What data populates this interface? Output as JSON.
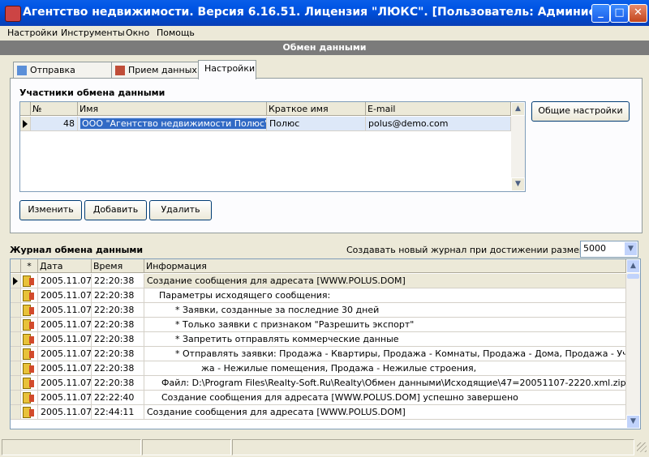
{
  "window": {
    "title": "Агентство недвижимости. Версия 6.16.51. Лицензия \"ЛЮКС\". [Пользователь: Администратор]"
  },
  "menu": [
    "Настройки",
    "Инструменты",
    "Окно",
    "Помощь"
  ],
  "section_title": "Обмен данными",
  "tabs": [
    {
      "label": "Отправка данных",
      "icon": "send-icon"
    },
    {
      "label": "Прием данных",
      "icon": "receive-icon"
    },
    {
      "label": "Настройки",
      "active": true
    }
  ],
  "participants": {
    "title": "Участники обмена данными",
    "columns": [
      "№",
      "Имя",
      "Краткое имя",
      "E-mail"
    ],
    "rows": [
      {
        "num": "48",
        "name": "ООО \"Агентство недвижимости Полюс\"",
        "short": "Полюс",
        "email": "polus@demo.com"
      }
    ],
    "buttons": {
      "edit": "Изменить",
      "add": "Добавить",
      "delete": "Удалить"
    },
    "general_settings": "Общие настройки"
  },
  "log": {
    "title": "Журнал обмена данными",
    "size_label": "Создавать новый журнал при достижении размера, Кб:",
    "size_value": "5000",
    "columns": [
      "*",
      "Дата",
      "Время",
      "Информация"
    ],
    "rows": [
      {
        "date": "2005.11.07",
        "time": "22:20:38",
        "info": "Создание сообщения для адресата [WWW.POLUS.DOM]"
      },
      {
        "date": "2005.11.07",
        "time": "22:20:38",
        "info": "Параметры исходящего сообщения:"
      },
      {
        "date": "2005.11.07",
        "time": "22:20:38",
        "info": "* Заявки, созданные за последние 30 дней"
      },
      {
        "date": "2005.11.07",
        "time": "22:20:38",
        "info": "* Только заявки с признаком \"Разрешить экспорт\""
      },
      {
        "date": "2005.11.07",
        "time": "22:20:38",
        "info": "* Запретить отправлять коммерческие данные"
      },
      {
        "date": "2005.11.07",
        "time": "22:20:38",
        "info": "* Отправлять заявки: Продажа - Квартиры, Продажа - Комнаты, Продажа - Дома, Продажа - Участки, Прода"
      },
      {
        "date": "2005.11.07",
        "time": "22:20:38",
        "info": "жа - Нежилые помещения, Продажа - Нежилые строения,"
      },
      {
        "date": "2005.11.07",
        "time": "22:20:38",
        "info": "Файл: D:\\Program Files\\Realty-Soft.Ru\\Realty\\Обмен данными\\Исходящие\\47=20051107-2220.xml.zip"
      },
      {
        "date": "2005.11.07",
        "time": "22:22:40",
        "info": "Создание сообщения для адресата [WWW.POLUS.DOM] успешно завершено"
      },
      {
        "date": "2005.11.07",
        "time": "22:44:11",
        "info": "Создание сообщения для адресата [WWW.POLUS.DOM]"
      }
    ]
  }
}
